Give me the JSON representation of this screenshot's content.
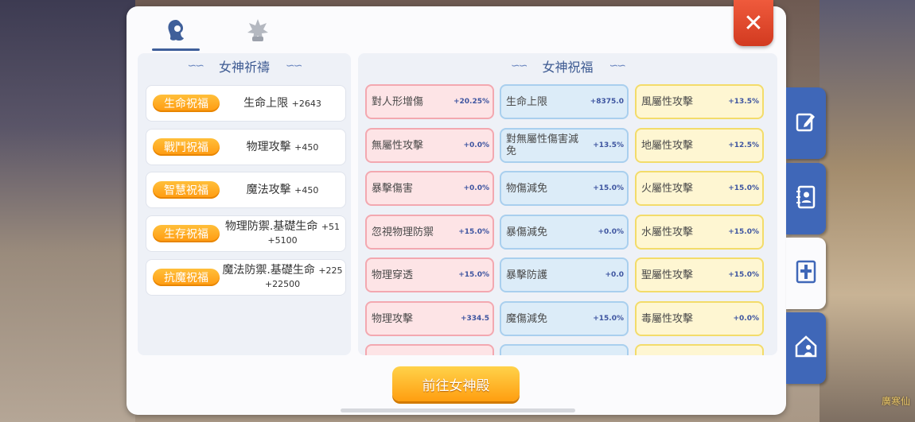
{
  "tabs": [
    {
      "icon": "goddess-head-icon",
      "active": true
    },
    {
      "icon": "star-emblem-icon",
      "active": false
    }
  ],
  "close_label": "✕",
  "prayer": {
    "title": "女神祈禱",
    "items": [
      {
        "badge": "生命祝福",
        "text": "生命上限",
        "value": "+2643",
        "value2": ""
      },
      {
        "badge": "戰鬥祝福",
        "text": "物理攻擊",
        "value": "+450",
        "value2": ""
      },
      {
        "badge": "智慧祝福",
        "text": "魔法攻擊",
        "value": "+450",
        "value2": ""
      },
      {
        "badge": "生存祝福",
        "text": "物理防禦.基礎生命",
        "value": "+51",
        "value2": "+5100"
      },
      {
        "badge": "抗魔祝福",
        "text": "魔法防禦.基礎生命",
        "value": "+225",
        "value2": "+22500"
      }
    ]
  },
  "blessing": {
    "title": "女神祝福",
    "rows": [
      [
        {
          "name": "對人形增傷",
          "value": "+20.25%"
        },
        {
          "name": "生命上限",
          "value": "+8375.0"
        },
        {
          "name": "風屬性攻擊",
          "value": "+13.5%"
        }
      ],
      [
        {
          "name": "無屬性攻擊",
          "value": "+0.0%"
        },
        {
          "name": "對無屬性傷害減免",
          "value": "+13.5%"
        },
        {
          "name": "地屬性攻擊",
          "value": "+12.5%"
        }
      ],
      [
        {
          "name": "暴擊傷害",
          "value": "+0.0%"
        },
        {
          "name": "物傷減免",
          "value": "+15.0%"
        },
        {
          "name": "火屬性攻擊",
          "value": "+15.0%"
        }
      ],
      [
        {
          "name": "忽視物理防禦",
          "value": "+15.0%"
        },
        {
          "name": "暴傷減免",
          "value": "+0.0%"
        },
        {
          "name": "水屬性攻擊",
          "value": "+15.0%"
        }
      ],
      [
        {
          "name": "物理穿透",
          "value": "+15.0%"
        },
        {
          "name": "暴擊防護",
          "value": "+0.0"
        },
        {
          "name": "聖屬性攻擊",
          "value": "+15.0%"
        }
      ],
      [
        {
          "name": "物理攻擊",
          "value": "+334.5"
        },
        {
          "name": "魔傷減免",
          "value": "+15.0%"
        },
        {
          "name": "毒屬性攻擊",
          "value": "+0.0%"
        }
      ]
    ]
  },
  "goto_button": "前往女神殿",
  "side_tabs": [
    {
      "icon": "edit-icon",
      "active": false
    },
    {
      "icon": "contact-book-icon",
      "active": false
    },
    {
      "icon": "cross-icon",
      "active": true
    },
    {
      "icon": "house-user-icon",
      "active": false
    }
  ],
  "background_text": "廣寒仙",
  "colors": {
    "accent": "#3f5f9a",
    "orange": "#ff9e10",
    "close": "#e04a2c"
  }
}
